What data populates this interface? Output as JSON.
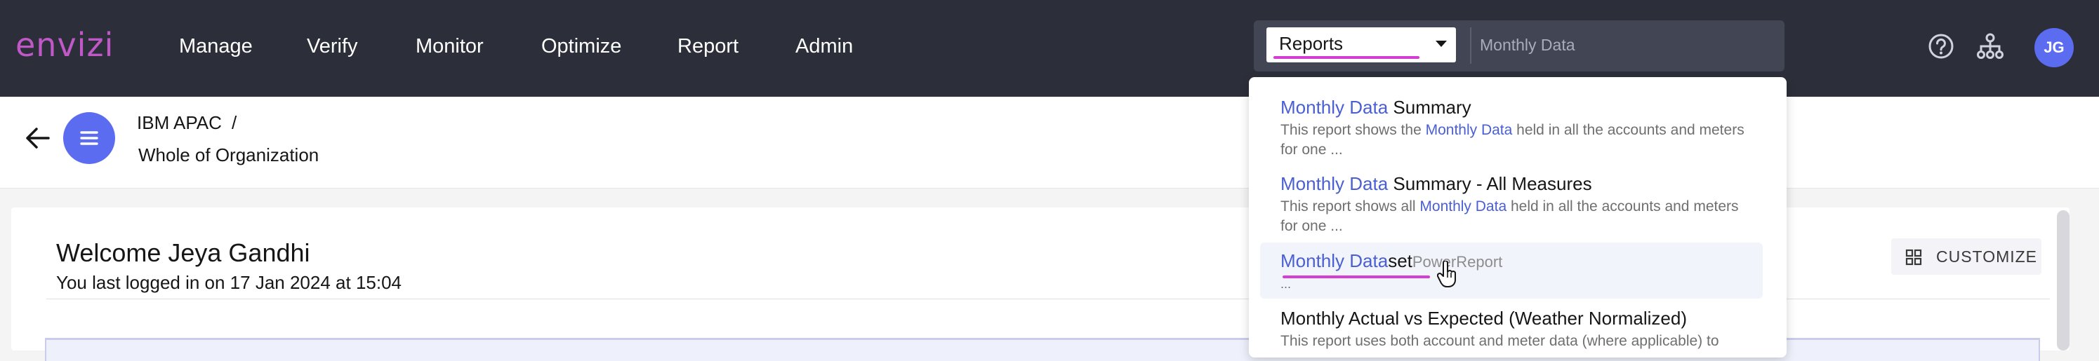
{
  "brand": {
    "logo_text": "envizi",
    "logo_color": "#c058c8"
  },
  "nav": {
    "items": [
      {
        "label": "Manage"
      },
      {
        "label": "Verify"
      },
      {
        "label": "Monitor"
      },
      {
        "label": "Optimize"
      },
      {
        "label": "Report"
      },
      {
        "label": "Admin"
      }
    ]
  },
  "search": {
    "scope_selected": "Reports",
    "query": "Monthly Data"
  },
  "header_icons": [
    "help-icon",
    "hierarchy-icon"
  ],
  "user": {
    "initials": "JG"
  },
  "breadcrumb": {
    "org": "IBM APAC",
    "separator": "/",
    "location": "Whole of Organization"
  },
  "welcome": {
    "title": "Welcome Jeya Gandhi",
    "last_login": "You last logged in on 17 Jan 2024 at 15:04"
  },
  "customize_label": "CUSTOMIZE",
  "dropdown": {
    "items": [
      {
        "title_hl": "Monthly Data",
        "title_rest": " Summary",
        "desc_pre": "This report shows the ",
        "desc_hl": "Monthly Data",
        "desc_post": " held in all the accounts and meters for one ..."
      },
      {
        "title_hl": "Monthly Data",
        "title_rest": " Summary - All Measures",
        "desc_pre": "This report shows all ",
        "desc_hl": "Monthly Data",
        "desc_post": " held in all the accounts and meters for one ..."
      },
      {
        "title_hl": "Monthly Data",
        "title_rest": "set",
        "title_typed": "PowerReport",
        "desc_pre": "...",
        "desc_hl": "",
        "desc_post": ""
      },
      {
        "title_hl": "",
        "title_rest": "Monthly Actual vs Expected (Weather Normalized)",
        "desc_pre": "This report uses both account and meter data (where applicable) to",
        "desc_hl": "",
        "desc_post": ""
      }
    ]
  },
  "colors": {
    "nav_bg": "#2c2f3a",
    "accent": "#5b6cf0",
    "highlight_text": "#4a5fd2",
    "underline": "#d43fd3"
  }
}
